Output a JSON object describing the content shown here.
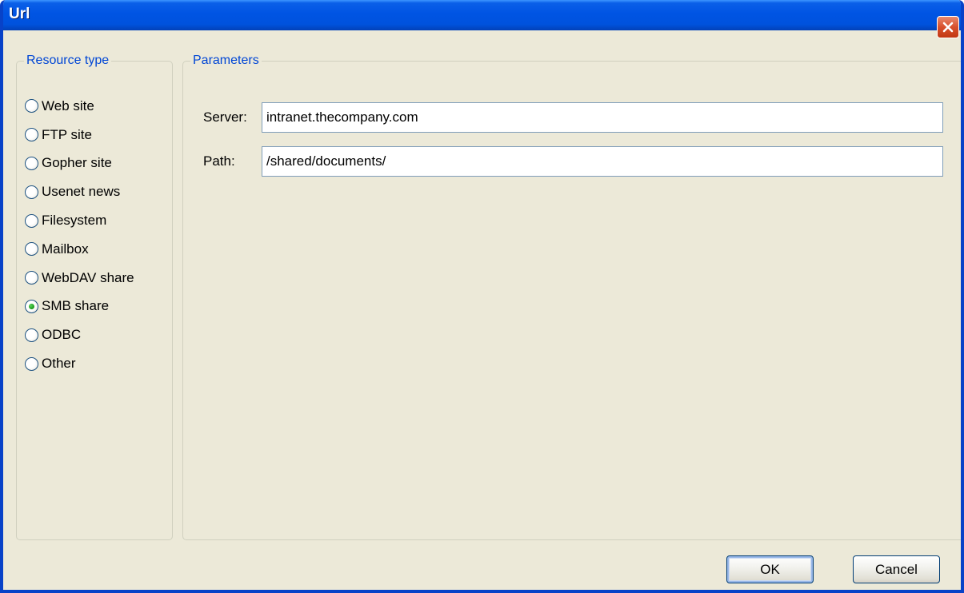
{
  "window": {
    "title": "Url",
    "close_icon": "close-icon"
  },
  "resource_type": {
    "legend": "Resource type",
    "selected": "SMB share",
    "options": [
      {
        "label": "Web site",
        "checked": false
      },
      {
        "label": "FTP site",
        "checked": false
      },
      {
        "label": "Gopher site",
        "checked": false
      },
      {
        "label": "Usenet news",
        "checked": false
      },
      {
        "label": "Filesystem",
        "checked": false
      },
      {
        "label": "Mailbox",
        "checked": false
      },
      {
        "label": "WebDAV share",
        "checked": false
      },
      {
        "label": "SMB share",
        "checked": true
      },
      {
        "label": "ODBC",
        "checked": false
      },
      {
        "label": "Other",
        "checked": false
      }
    ]
  },
  "parameters": {
    "legend": "Parameters",
    "server_label": "Server:",
    "server_value": "intranet.thecompany.com",
    "path_label": "Path:",
    "path_value": "/shared/documents/"
  },
  "buttons": {
    "ok_label": "OK",
    "cancel_label": "Cancel"
  },
  "colors": {
    "titlebar": "#0054e3",
    "window_bg": "#ece9d8",
    "legend_text": "#0046d5",
    "close_button": "#d8502c",
    "radio_checked": "#21a121"
  }
}
